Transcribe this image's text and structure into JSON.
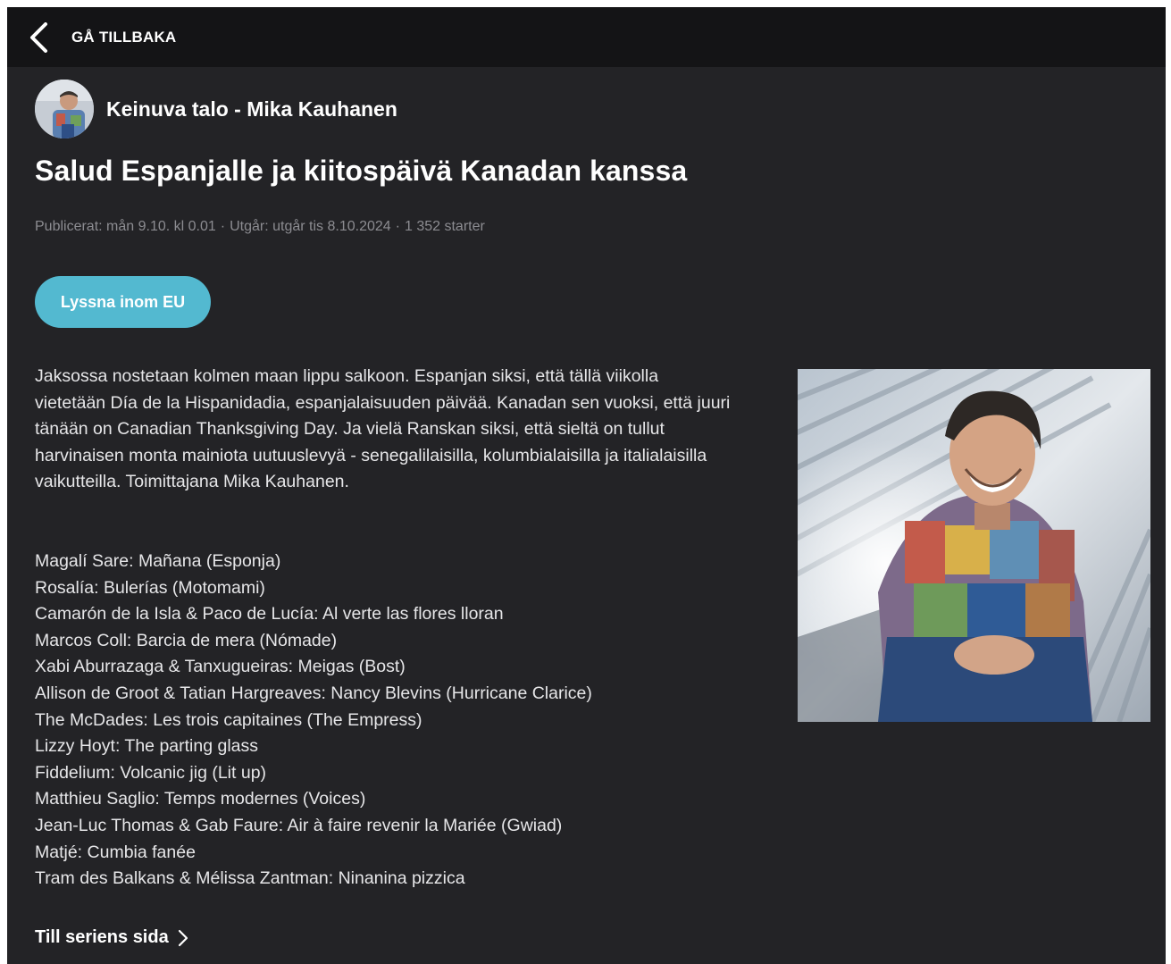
{
  "topbar": {
    "back_label": "GÅ TILLBAKA",
    "back_icon": "chevron-left-icon"
  },
  "series": {
    "title": "Keinuva talo - Mika Kauhanen"
  },
  "episode": {
    "title": "Salud Espanjalle ja kiitospäivä Kanadan kanssa",
    "meta": {
      "published": "Publicerat: mån 9.10. kl 0.01",
      "expires": "Utgår: utgår tis 8.10.2024",
      "starts": "1 352 starter",
      "separator": "·"
    },
    "listen_button": "Lyssna inom EU",
    "description": "Jaksossa nostetaan kolmen maan lippu salkoon. Espanjan siksi, että tällä viikolla vietetään Día de la Hispanidadia, espanjalaisuuden päivää. Kanadan sen vuoksi, että juuri tänään on Canadian Thanksgiving Day. Ja vielä Ranskan siksi, että sieltä on tullut harvinaisen monta mainiota uutuuslevyä - senegalilaisilla, kolumbialaisilla ja italialaisilla vaikutteilla. Toimittajana Mika Kauhanen.",
    "playlist": [
      "Magalí Sare: Mañana (Esponja)",
      "Rosalía: Bulerías (Motomami)",
      "Camarón de la Isla & Paco de Lucía: Al verte las flores lloran",
      "Marcos Coll: Barcia de mera (Nómade)",
      "Xabi Aburrazaga & Tanxugueiras: Meigas (Bost)",
      "Allison de Groot & Tatian Hargreaves: Nancy Blevins (Hurricane Clarice)",
      "The McDades: Les trois capitaines (The Empress)",
      "Lizzy Hoyt: The parting glass",
      "Fiddelium: Volcanic jig (Lit up)",
      "Matthieu Saglio: Temps modernes (Voices)",
      "Jean-Luc Thomas & Gab Faure: Air à faire revenir la Mariée (Gwiad)",
      "Matjé: Cumbia fanée",
      "Tram des Balkans & Mélissa Zantman: Ninanina pizzica"
    ]
  },
  "footer": {
    "series_link": "Till seriens sida",
    "series_link_icon": "chevron-right-icon"
  },
  "colors": {
    "background": "#232326",
    "topbar": "#141416",
    "accent_button": "#53b9d0",
    "meta_text": "#8c8c91"
  }
}
